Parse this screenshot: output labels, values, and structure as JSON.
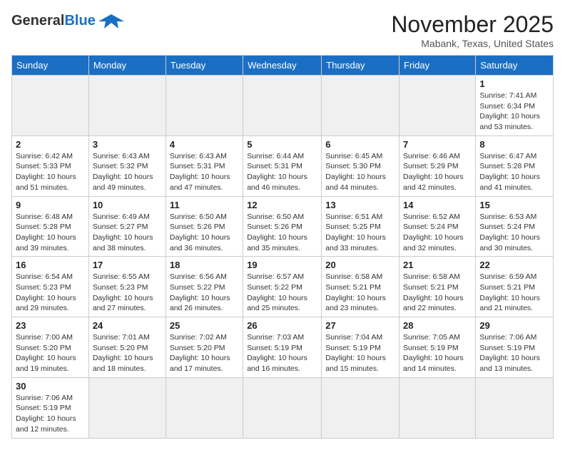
{
  "header": {
    "logo_general": "General",
    "logo_blue": "Blue",
    "month": "November 2025",
    "location": "Mabank, Texas, United States"
  },
  "days_of_week": [
    "Sunday",
    "Monday",
    "Tuesday",
    "Wednesday",
    "Thursday",
    "Friday",
    "Saturday"
  ],
  "weeks": [
    [
      {
        "day": "",
        "sunrise": "",
        "sunset": "",
        "daylight": ""
      },
      {
        "day": "",
        "sunrise": "",
        "sunset": "",
        "daylight": ""
      },
      {
        "day": "",
        "sunrise": "",
        "sunset": "",
        "daylight": ""
      },
      {
        "day": "",
        "sunrise": "",
        "sunset": "",
        "daylight": ""
      },
      {
        "day": "",
        "sunrise": "",
        "sunset": "",
        "daylight": ""
      },
      {
        "day": "",
        "sunrise": "",
        "sunset": "",
        "daylight": ""
      },
      {
        "day": "1",
        "sunrise": "Sunrise: 7:41 AM",
        "sunset": "Sunset: 6:34 PM",
        "daylight": "Daylight: 10 hours and 53 minutes."
      }
    ],
    [
      {
        "day": "2",
        "sunrise": "Sunrise: 6:42 AM",
        "sunset": "Sunset: 5:33 PM",
        "daylight": "Daylight: 10 hours and 51 minutes."
      },
      {
        "day": "3",
        "sunrise": "Sunrise: 6:43 AM",
        "sunset": "Sunset: 5:32 PM",
        "daylight": "Daylight: 10 hours and 49 minutes."
      },
      {
        "day": "4",
        "sunrise": "Sunrise: 6:43 AM",
        "sunset": "Sunset: 5:31 PM",
        "daylight": "Daylight: 10 hours and 47 minutes."
      },
      {
        "day": "5",
        "sunrise": "Sunrise: 6:44 AM",
        "sunset": "Sunset: 5:31 PM",
        "daylight": "Daylight: 10 hours and 46 minutes."
      },
      {
        "day": "6",
        "sunrise": "Sunrise: 6:45 AM",
        "sunset": "Sunset: 5:30 PM",
        "daylight": "Daylight: 10 hours and 44 minutes."
      },
      {
        "day": "7",
        "sunrise": "Sunrise: 6:46 AM",
        "sunset": "Sunset: 5:29 PM",
        "daylight": "Daylight: 10 hours and 42 minutes."
      },
      {
        "day": "8",
        "sunrise": "Sunrise: 6:47 AM",
        "sunset": "Sunset: 5:28 PM",
        "daylight": "Daylight: 10 hours and 41 minutes."
      }
    ],
    [
      {
        "day": "9",
        "sunrise": "Sunrise: 6:48 AM",
        "sunset": "Sunset: 5:28 PM",
        "daylight": "Daylight: 10 hours and 39 minutes."
      },
      {
        "day": "10",
        "sunrise": "Sunrise: 6:49 AM",
        "sunset": "Sunset: 5:27 PM",
        "daylight": "Daylight: 10 hours and 38 minutes."
      },
      {
        "day": "11",
        "sunrise": "Sunrise: 6:50 AM",
        "sunset": "Sunset: 5:26 PM",
        "daylight": "Daylight: 10 hours and 36 minutes."
      },
      {
        "day": "12",
        "sunrise": "Sunrise: 6:50 AM",
        "sunset": "Sunset: 5:26 PM",
        "daylight": "Daylight: 10 hours and 35 minutes."
      },
      {
        "day": "13",
        "sunrise": "Sunrise: 6:51 AM",
        "sunset": "Sunset: 5:25 PM",
        "daylight": "Daylight: 10 hours and 33 minutes."
      },
      {
        "day": "14",
        "sunrise": "Sunrise: 6:52 AM",
        "sunset": "Sunset: 5:24 PM",
        "daylight": "Daylight: 10 hours and 32 minutes."
      },
      {
        "day": "15",
        "sunrise": "Sunrise: 6:53 AM",
        "sunset": "Sunset: 5:24 PM",
        "daylight": "Daylight: 10 hours and 30 minutes."
      }
    ],
    [
      {
        "day": "16",
        "sunrise": "Sunrise: 6:54 AM",
        "sunset": "Sunset: 5:23 PM",
        "daylight": "Daylight: 10 hours and 29 minutes."
      },
      {
        "day": "17",
        "sunrise": "Sunrise: 6:55 AM",
        "sunset": "Sunset: 5:23 PM",
        "daylight": "Daylight: 10 hours and 27 minutes."
      },
      {
        "day": "18",
        "sunrise": "Sunrise: 6:56 AM",
        "sunset": "Sunset: 5:22 PM",
        "daylight": "Daylight: 10 hours and 26 minutes."
      },
      {
        "day": "19",
        "sunrise": "Sunrise: 6:57 AM",
        "sunset": "Sunset: 5:22 PM",
        "daylight": "Daylight: 10 hours and 25 minutes."
      },
      {
        "day": "20",
        "sunrise": "Sunrise: 6:58 AM",
        "sunset": "Sunset: 5:21 PM",
        "daylight": "Daylight: 10 hours and 23 minutes."
      },
      {
        "day": "21",
        "sunrise": "Sunrise: 6:58 AM",
        "sunset": "Sunset: 5:21 PM",
        "daylight": "Daylight: 10 hours and 22 minutes."
      },
      {
        "day": "22",
        "sunrise": "Sunrise: 6:59 AM",
        "sunset": "Sunset: 5:21 PM",
        "daylight": "Daylight: 10 hours and 21 minutes."
      }
    ],
    [
      {
        "day": "23",
        "sunrise": "Sunrise: 7:00 AM",
        "sunset": "Sunset: 5:20 PM",
        "daylight": "Daylight: 10 hours and 19 minutes."
      },
      {
        "day": "24",
        "sunrise": "Sunrise: 7:01 AM",
        "sunset": "Sunset: 5:20 PM",
        "daylight": "Daylight: 10 hours and 18 minutes."
      },
      {
        "day": "25",
        "sunrise": "Sunrise: 7:02 AM",
        "sunset": "Sunset: 5:20 PM",
        "daylight": "Daylight: 10 hours and 17 minutes."
      },
      {
        "day": "26",
        "sunrise": "Sunrise: 7:03 AM",
        "sunset": "Sunset: 5:19 PM",
        "daylight": "Daylight: 10 hours and 16 minutes."
      },
      {
        "day": "27",
        "sunrise": "Sunrise: 7:04 AM",
        "sunset": "Sunset: 5:19 PM",
        "daylight": "Daylight: 10 hours and 15 minutes."
      },
      {
        "day": "28",
        "sunrise": "Sunrise: 7:05 AM",
        "sunset": "Sunset: 5:19 PM",
        "daylight": "Daylight: 10 hours and 14 minutes."
      },
      {
        "day": "29",
        "sunrise": "Sunrise: 7:06 AM",
        "sunset": "Sunset: 5:19 PM",
        "daylight": "Daylight: 10 hours and 13 minutes."
      }
    ],
    [
      {
        "day": "30",
        "sunrise": "Sunrise: 7:06 AM",
        "sunset": "Sunset: 5:19 PM",
        "daylight": "Daylight: 10 hours and 12 minutes."
      },
      {
        "day": "",
        "sunrise": "",
        "sunset": "",
        "daylight": ""
      },
      {
        "day": "",
        "sunrise": "",
        "sunset": "",
        "daylight": ""
      },
      {
        "day": "",
        "sunrise": "",
        "sunset": "",
        "daylight": ""
      },
      {
        "day": "",
        "sunrise": "",
        "sunset": "",
        "daylight": ""
      },
      {
        "day": "",
        "sunrise": "",
        "sunset": "",
        "daylight": ""
      },
      {
        "day": "",
        "sunrise": "",
        "sunset": "",
        "daylight": ""
      }
    ]
  ]
}
